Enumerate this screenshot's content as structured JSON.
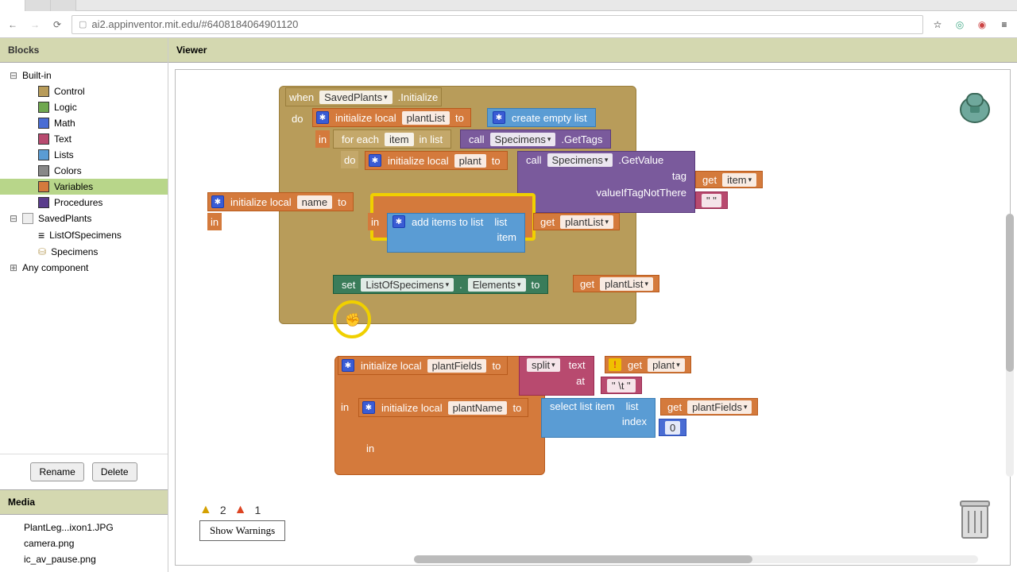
{
  "url": "ai2.appinventor.mit.edu/#6408184064901120",
  "panels": {
    "blocks": "Blocks",
    "viewer": "Viewer",
    "media": "Media"
  },
  "tree": {
    "builtin": "Built-in",
    "cats": [
      "Control",
      "Logic",
      "Math",
      "Text",
      "Lists",
      "Colors",
      "Variables",
      "Procedures"
    ],
    "screen": "SavedPlants",
    "comps": [
      "ListOfSpecimens",
      "Specimens"
    ],
    "any": "Any component"
  },
  "buttons": {
    "rename": "Rename",
    "delete": "Delete",
    "show_warnings": "Show Warnings"
  },
  "media": [
    "PlantLeg...ixon1.JPG",
    "camera.png",
    "ic_av_pause.png"
  ],
  "warnings": {
    "warn_count": "2",
    "error_count": "1"
  },
  "blocks": {
    "when": "when",
    "initialize": ".Initialize",
    "do": "do",
    "in": "in",
    "init_local": "initialize local",
    "to": "to",
    "create_empty": "create empty list",
    "for_each": "for each",
    "item": "item",
    "in_list": "in list",
    "call": "call",
    "get_tags": ".GetTags",
    "get_value": ".GetValue",
    "tag": "tag",
    "vintnt": "valueIfTagNotThere",
    "get": "get",
    "set": "set",
    "add_items": "add items to list",
    "list": "list",
    "elements": "Elements",
    "split": "split",
    "text": "text",
    "at": "at",
    "select_item": "select list item",
    "index": "index",
    "v_plantList": "plantList",
    "v_plant": "plant",
    "v_name": "name",
    "v_plantFields": "plantFields",
    "v_plantName": "plantName",
    "c_SavedPlants": "SavedPlants",
    "c_Specimens": "Specimens",
    "c_ListOfSpecimens": "ListOfSpecimens",
    "q_empty": "\" \"",
    "q_tab": "\" \\t \"",
    "zero": "0"
  }
}
